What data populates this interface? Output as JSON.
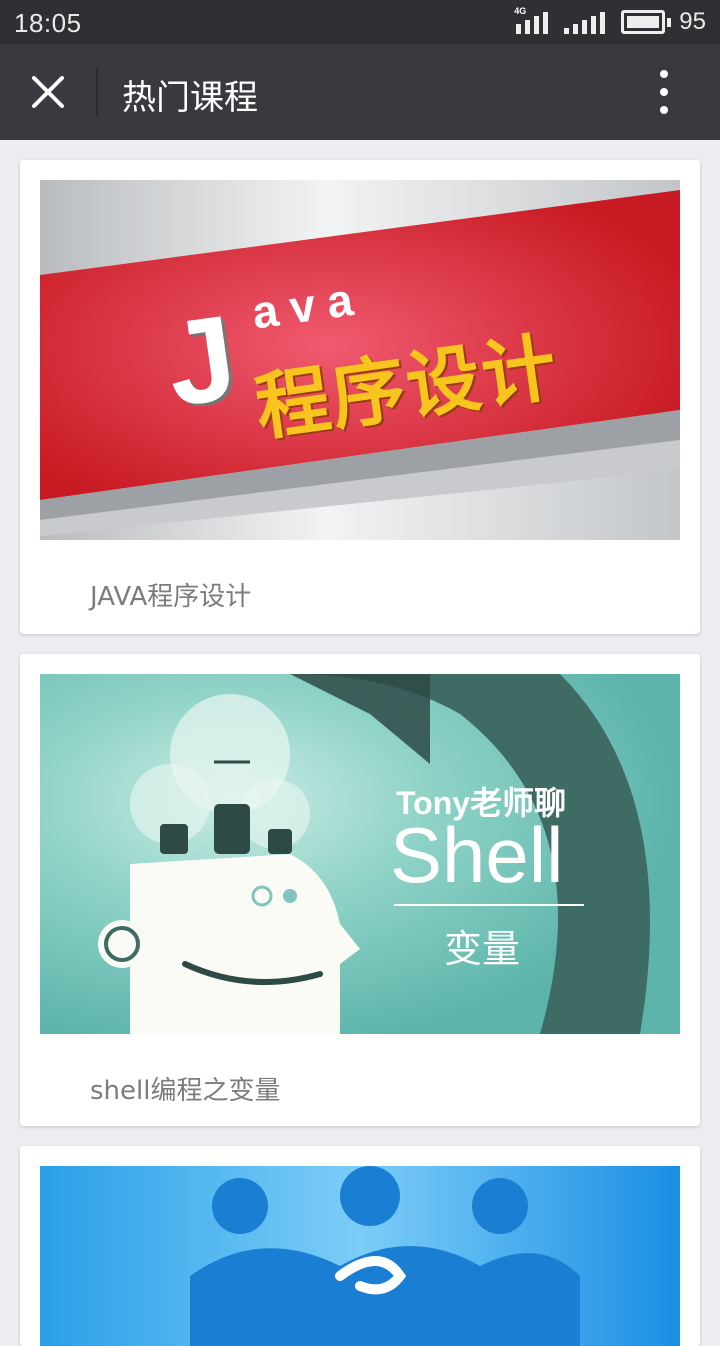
{
  "status_bar": {
    "time": "18:05",
    "network": "4G",
    "battery": "95"
  },
  "app_bar": {
    "title": "热门课程"
  },
  "courses": [
    {
      "title": "JAVA程序设计",
      "banner_letter": "J",
      "banner_suffix": "ava",
      "banner_text": "程序设计"
    },
    {
      "title": "shell编程之变量",
      "banner_line1": "Tony老师聊",
      "banner_line2": "Shell",
      "banner_line3": "变量"
    },
    {
      "title": ""
    }
  ],
  "colors": {
    "status_bg": "#2f3033",
    "app_bar_bg": "#393a3f",
    "page_bg": "#ebedf1",
    "java_red": "#d32030",
    "java_yellow": "#f7c51e",
    "shell_teal": "#5fb7ad"
  }
}
